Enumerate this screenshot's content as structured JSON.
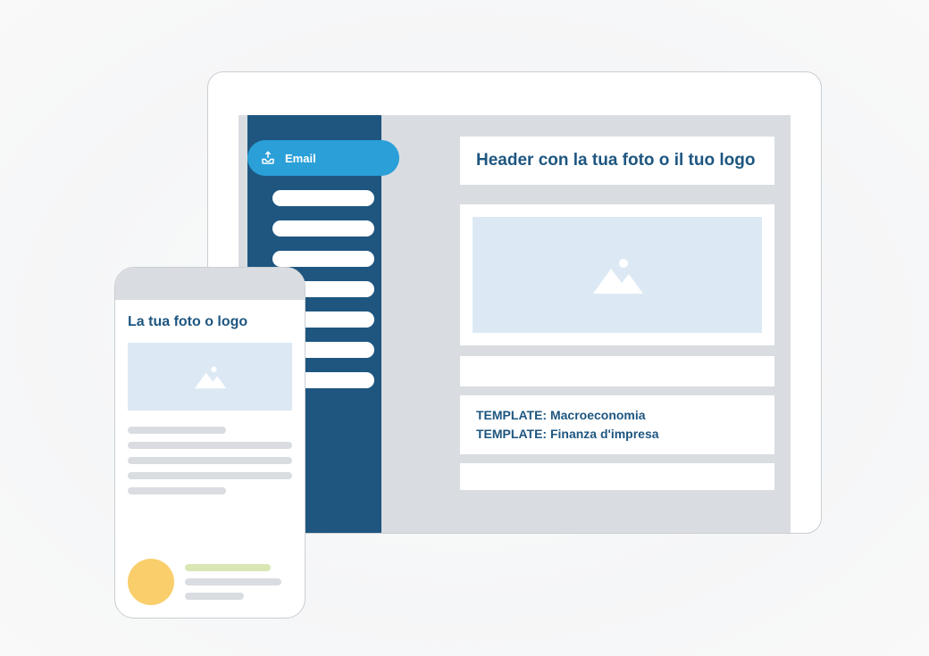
{
  "sidebar": {
    "email_label": "Email",
    "icon": "email-outbox-icon"
  },
  "desktop": {
    "header_title": "Header con la tua foto o il tuo logo",
    "templates": [
      "TEMPLATE: Macroeconomia",
      "TEMPLATE: Finanza d'impresa"
    ]
  },
  "phone": {
    "header_title": "La tua foto o logo"
  },
  "colors": {
    "brand_dark": "#1e5680",
    "brand_light": "#2a9fd8",
    "placeholder_bg": "#dce9f5",
    "chrome": "#d9dde1",
    "accent_yellow": "#f9ce6b",
    "accent_green": "#d9e7b4"
  }
}
